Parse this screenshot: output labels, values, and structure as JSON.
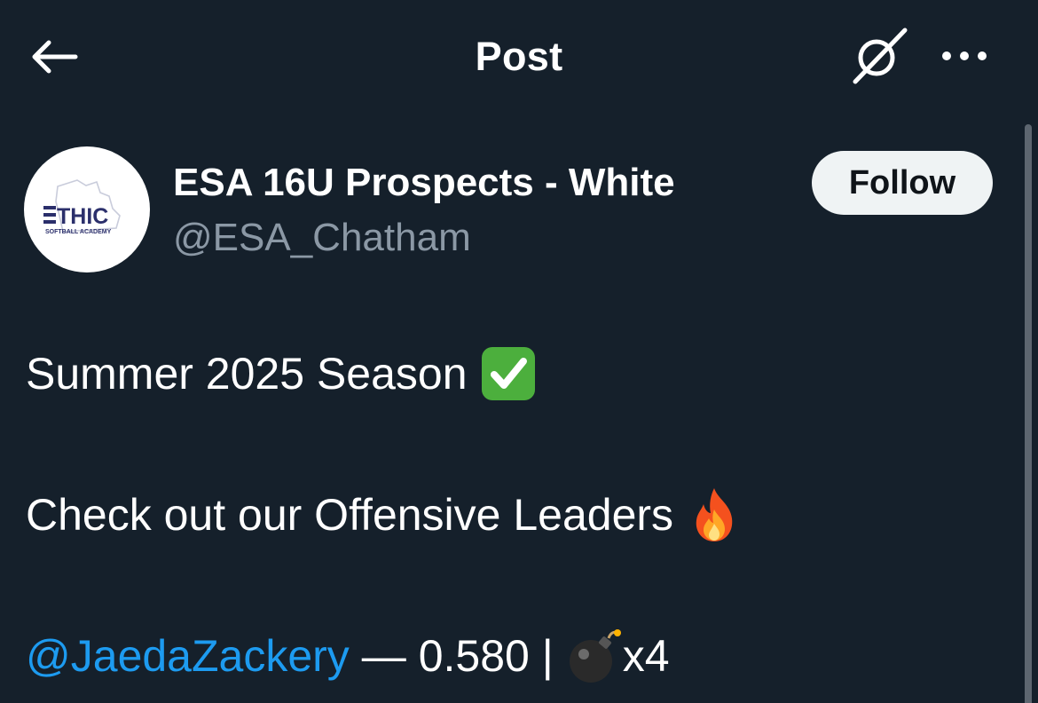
{
  "header": {
    "title": "Post",
    "back_icon": "arrow-left-icon",
    "grok_icon": "grok-icon",
    "more_icon": "more-horizontal-icon"
  },
  "author": {
    "name": "ESA 16U Prospects - White",
    "handle": "@ESA_Chatham",
    "avatar": {
      "logo_text": "ETHIC",
      "logo_subtext": "SOFTBALL ACADEMY",
      "logo_color": "#2b2f6b"
    },
    "follow_label": "Follow"
  },
  "post": {
    "line1": {
      "text": "Summer 2025 Season",
      "emoji": "check-mark-button-icon"
    },
    "line2": {
      "text": "Check out our Offensive Leaders",
      "emoji": "fire-icon"
    },
    "line3": {
      "mention": "@JaedaZackery",
      "stats": "— 0.580 |",
      "emoji": "bomb-icon",
      "suffix": "x4"
    }
  },
  "colors": {
    "background": "#15202b",
    "text": "#ffffff",
    "secondary_text": "#8b98a5",
    "link": "#1d9bf0",
    "follow_bg": "#eff3f4",
    "follow_text": "#0f1419"
  }
}
